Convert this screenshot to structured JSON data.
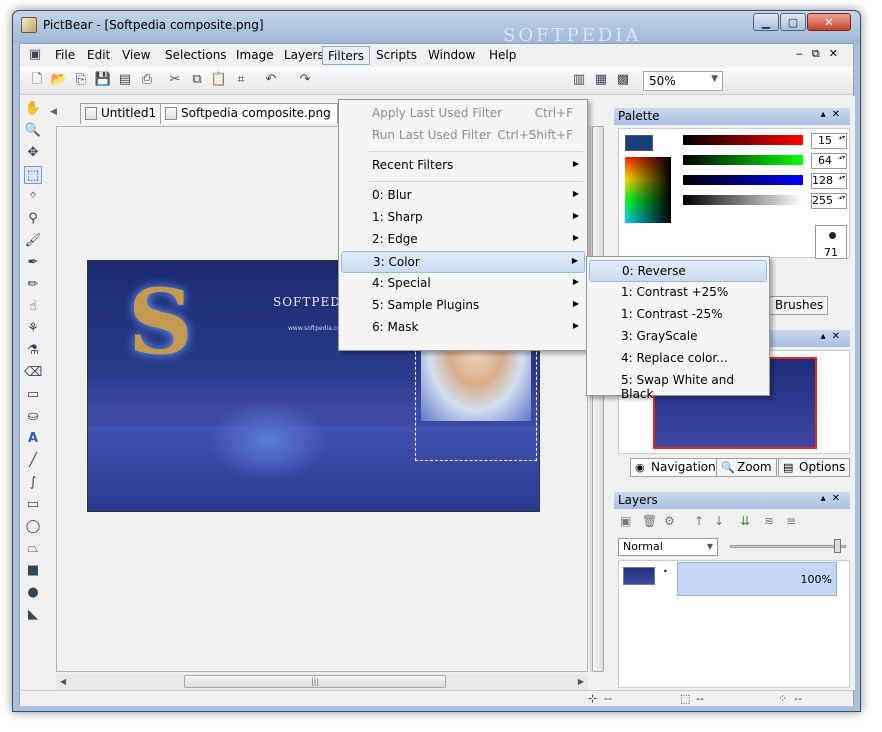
{
  "window": {
    "title": "PictBear - [Softpedia composite.png]",
    "watermark": "SOFTPEDIA"
  },
  "menubar": {
    "items": [
      "File",
      "Edit",
      "View",
      "Selections",
      "Image",
      "Layers",
      "Filters",
      "Scripts",
      "Window",
      "Help"
    ]
  },
  "toolbar": {
    "zoom": "50%"
  },
  "tabs": [
    {
      "label": "Untitled1"
    },
    {
      "label": "Softpedia composite.png"
    }
  ],
  "image": {
    "brand": "SOFTPEDIA",
    "url": "www.softpedia.com"
  },
  "filters_menu": {
    "apply_last": {
      "label": "Apply Last Used Filter",
      "shortcut": "Ctrl+F"
    },
    "run_last": {
      "label": "Run Last Used Filter",
      "shortcut": "Ctrl+Shift+F"
    },
    "recent": "Recent Filters",
    "items": [
      "0: Blur",
      "1: Sharp",
      "2: Edge",
      "3: Color",
      "4: Special",
      "5: Sample Plugins",
      "6: Mask"
    ]
  },
  "color_submenu": {
    "items": [
      "0: Reverse",
      "1: Contrast +25%",
      "1: Contrast -25%",
      "3: GrayScale",
      "4: Replace color...",
      "5: Swap White and Black"
    ]
  },
  "palette": {
    "title": "Palette",
    "r": "15",
    "g": "64",
    "b": "128",
    "a": "255",
    "brush_size": "71",
    "fg_color": "#1a3f7f"
  },
  "palette_tabs": {
    "brushes": "Brushes"
  },
  "navigation_tabs": {
    "navigation": "Navigation",
    "zoom": "Zoom",
    "options": "Options"
  },
  "layers": {
    "title": "Layers",
    "blend_mode": "Normal",
    "opacity": "100%"
  },
  "status": {
    "pos": "--",
    "size": "--",
    "color": "--"
  }
}
